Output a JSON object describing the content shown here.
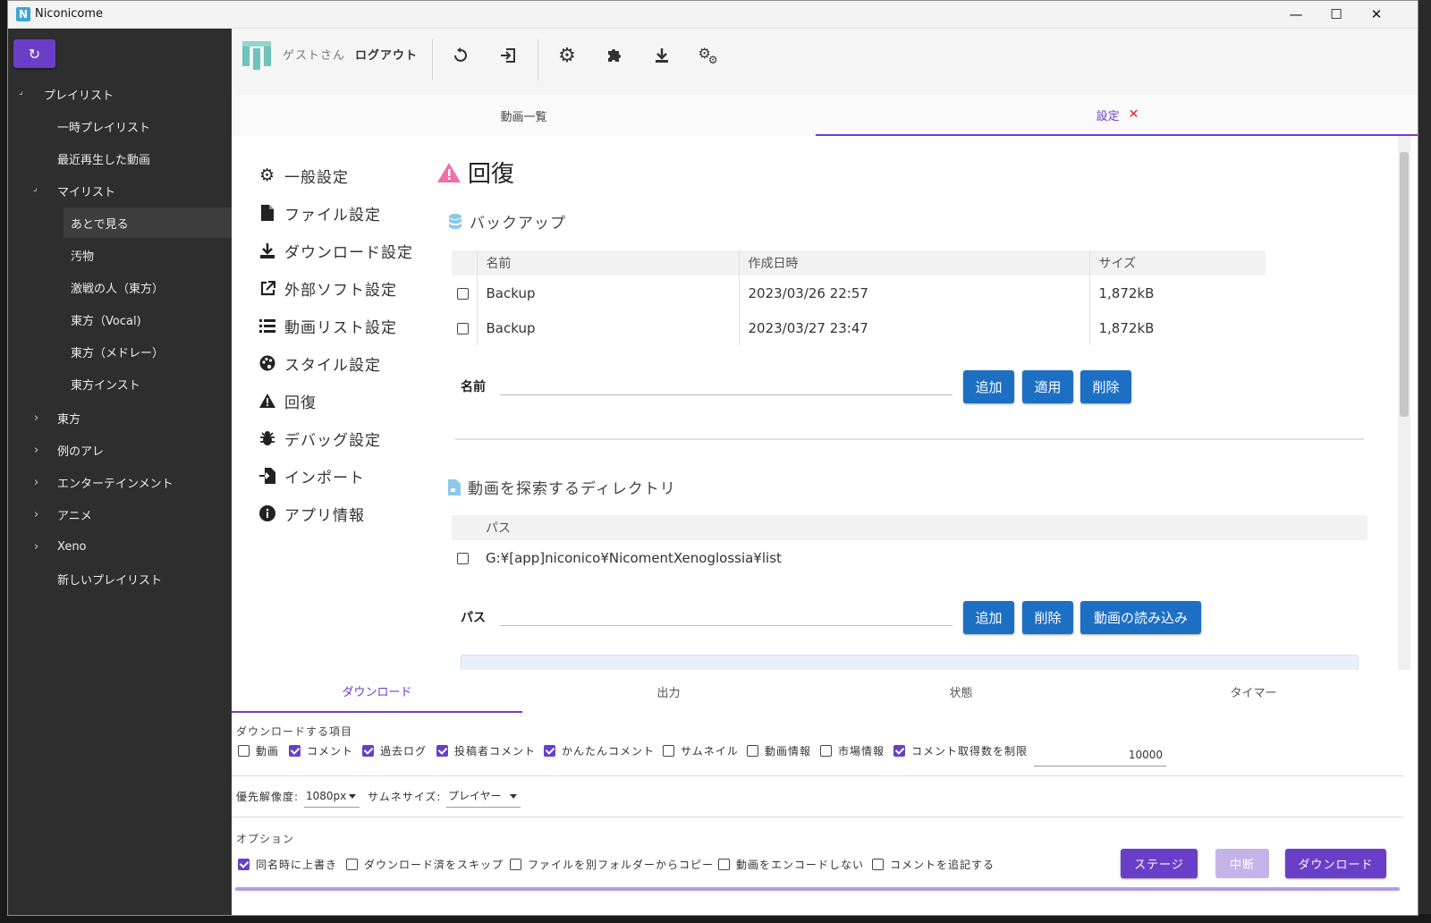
{
  "window": {
    "title": "Niconicome",
    "app_icon_letter": "N",
    "minimize": "—",
    "maximize": "☐",
    "close": "✕"
  },
  "sidebar": {
    "refresh_icon": "refresh-icon",
    "items": [
      {
        "label": "プレイリスト",
        "arrow": "⌟"
      },
      {
        "label": "一時プレイリスト"
      },
      {
        "label": "最近再生した動画"
      },
      {
        "label": "マイリスト",
        "arrow": "⌟"
      },
      {
        "label": "あとで見る"
      },
      {
        "label": "汚物"
      },
      {
        "label": "激戦の人（東方）"
      },
      {
        "label": "東方（Vocal)"
      },
      {
        "label": "東方（メドレー）"
      },
      {
        "label": "東方インスト"
      },
      {
        "label": "東方",
        "arrow": "›"
      },
      {
        "label": "例のアレ",
        "arrow": "›"
      },
      {
        "label": "エンターテインメント",
        "arrow": "›"
      },
      {
        "label": "アニメ",
        "arrow": "›"
      },
      {
        "label": "Xeno",
        "arrow": "›"
      },
      {
        "label": "新しいプレイリスト"
      }
    ]
  },
  "toolbar": {
    "guest": "ゲストさん",
    "logout": "ログアウト"
  },
  "tabs": [
    {
      "label": "動画一覧"
    },
    {
      "label": "設定",
      "close": "✕"
    }
  ],
  "settings_nav": [
    {
      "label": "一般設定",
      "icon": "gear-icon"
    },
    {
      "label": "ファイル設定",
      "icon": "file-icon"
    },
    {
      "label": "ダウンロード設定",
      "icon": "download-icon"
    },
    {
      "label": "外部ソフト設定",
      "icon": "external-link-icon"
    },
    {
      "label": "動画リスト設定",
      "icon": "list-icon"
    },
    {
      "label": "スタイル設定",
      "icon": "palette-icon"
    },
    {
      "label": "回復",
      "icon": "warning-icon"
    },
    {
      "label": "デバッグ設定",
      "icon": "bug-icon"
    },
    {
      "label": "インポート",
      "icon": "import-icon"
    },
    {
      "label": "アプリ情報",
      "icon": "info-icon"
    }
  ],
  "recovery": {
    "title": "回復",
    "backup": {
      "title": "バックアップ",
      "headers": [
        "名前",
        "作成日時",
        "サイズ"
      ],
      "rows": [
        {
          "name": "Backup",
          "date": "2023/03/26 22:57",
          "size": "1,872kB"
        },
        {
          "name": "Backup",
          "date": "2023/03/27 23:47",
          "size": "1,872kB"
        }
      ],
      "name_label": "名前",
      "name_value": "",
      "buttons": {
        "add": "追加",
        "apply": "適用",
        "delete": "削除"
      }
    },
    "directory": {
      "title": "動画を探索するディレクトリ",
      "header": "パス",
      "rows": [
        {
          "path": "G:¥[app]niconico¥NicomentXenoglossia¥list"
        }
      ],
      "path_label": "パス",
      "path_value": "",
      "buttons": {
        "add": "追加",
        "delete": "削除",
        "load": "動画の読み込み"
      }
    }
  },
  "bottom": {
    "tabs": [
      "ダウンロード",
      "出力",
      "状態",
      "タイマー"
    ],
    "items_label": "ダウンロードする項目",
    "items": [
      {
        "label": "動画",
        "checked": false
      },
      {
        "label": "コメント",
        "checked": true
      },
      {
        "label": "過去ログ",
        "checked": true
      },
      {
        "label": "投稿者コメント",
        "checked": true
      },
      {
        "label": "かんたんコメント",
        "checked": true
      },
      {
        "label": "サムネイル",
        "checked": false
      },
      {
        "label": "動画情報",
        "checked": false
      },
      {
        "label": "市場情報",
        "checked": false
      },
      {
        "label": "コメント取得数を制限",
        "checked": true
      }
    ],
    "comment_limit": "10000",
    "resolution_label": "優先解像度:",
    "resolution_value": "1080px",
    "thumb_label": "サムネサイズ:",
    "thumb_value": "プレイヤー",
    "options_label": "オプション",
    "options": [
      {
        "label": "同名時に上書き",
        "checked": true
      },
      {
        "label": "ダウンロード済をスキップ",
        "checked": false
      },
      {
        "label": "ファイルを別フォルダーからコピー",
        "checked": false
      },
      {
        "label": "動画をエンコードしない",
        "checked": false
      },
      {
        "label": "コメントを追記する",
        "checked": false
      }
    ],
    "buttons": {
      "stage": "ステージ",
      "stop": "中断",
      "download": "ダウンロード"
    }
  },
  "colors": {
    "accent": "#6a3fc8",
    "primary_button": "#1d6fc4",
    "disabled_button": "#c4b3e8",
    "sidebar_bg": "#2e2e2e"
  }
}
